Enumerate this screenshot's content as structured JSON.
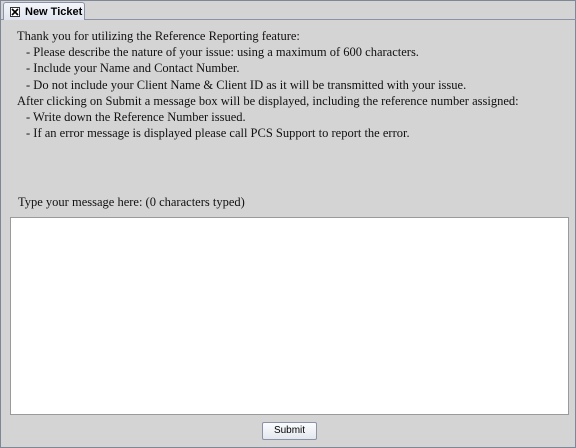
{
  "tab": {
    "icon": "close-box-icon",
    "label": "New Ticket"
  },
  "instructions": {
    "intro": "Thank you for utilizing the Reference Reporting feature:",
    "bullets1": [
      "- Please describe the nature of your issue: using a maximum of 600 characters.",
      "- Include your Name and Contact Number.",
      "- Do not include your Client Name & Client ID as it will be transmitted with your issue."
    ],
    "after_submit": "After clicking on Submit a message box will be displayed, including the reference number assigned:",
    "bullets2": [
      "- Write down the Reference Number issued.",
      "- If an error message is displayed please call PCS Support to report the error."
    ]
  },
  "message": {
    "prompt": "Type your message here: (0 characters typed)",
    "value": ""
  },
  "actions": {
    "submit_label": "Submit"
  },
  "colors": {
    "panel_bg": "#d4d4d4",
    "border": "#8a93a6"
  }
}
